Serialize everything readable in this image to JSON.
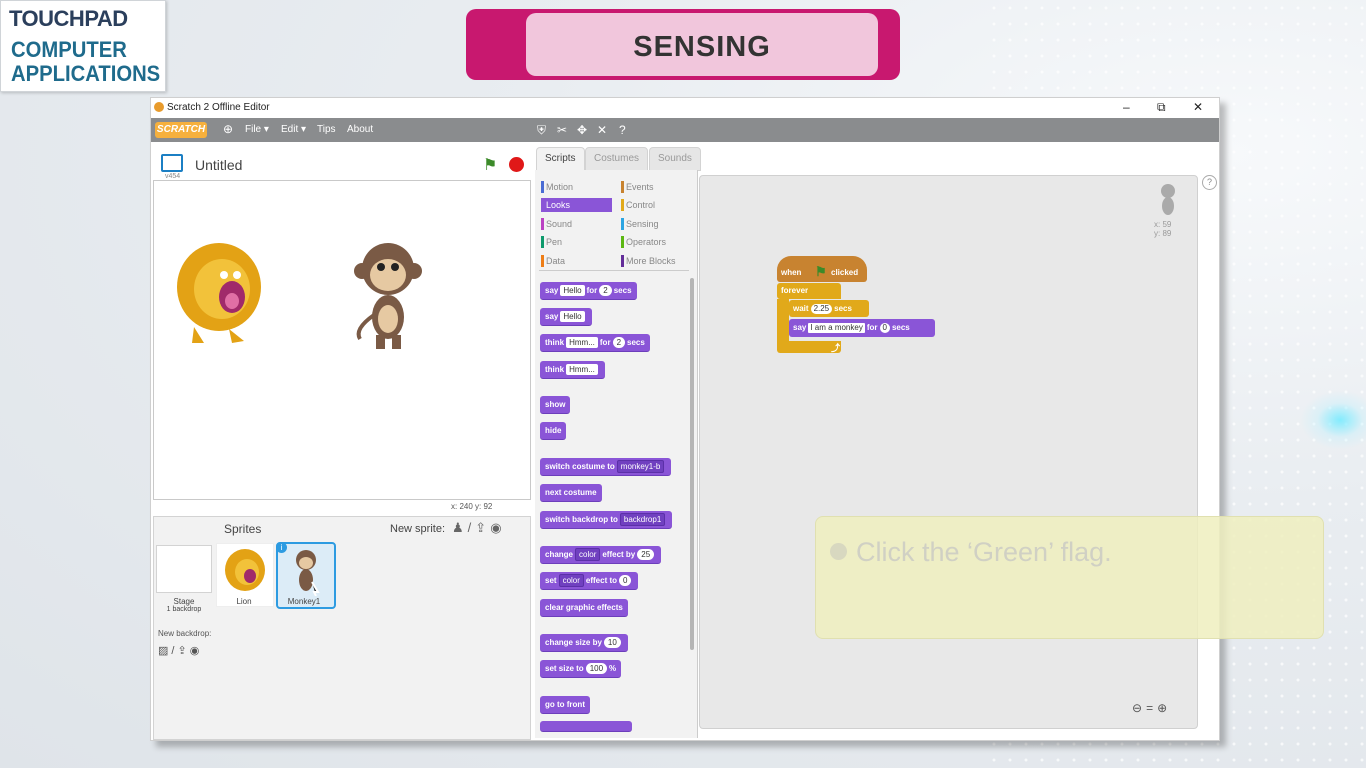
{
  "logo": {
    "brand": "TOUCHPAD",
    "line1": "COMPUTER",
    "line2": "APPLICATIONS"
  },
  "banner": {
    "title": "SENSING"
  },
  "window": {
    "title": "Scratch 2 Offline Editor",
    "controls": {
      "minimize": "–",
      "restore": "⧉",
      "close": "✕"
    }
  },
  "menubar": {
    "logo": "SCRATCH",
    "items": [
      "File ▾",
      "Edit ▾",
      "Tips",
      "About"
    ],
    "tools": [
      "duplicate-icon",
      "delete-icon",
      "grow-icon",
      "shrink-icon",
      "help-icon"
    ]
  },
  "stage": {
    "project_name": "Untitled",
    "version": "v454",
    "coords": "x: 240  y: 92"
  },
  "sprites_panel": {
    "header": "Sprites",
    "new_sprite": "New sprite:",
    "stage_label": "Stage",
    "stage_sub": "1 backdrop",
    "sprites": [
      "Lion",
      "Monkey1"
    ],
    "new_backdrop": "New backdrop:"
  },
  "tabs": [
    "Scripts",
    "Costumes",
    "Sounds"
  ],
  "categories": [
    {
      "label": "Motion",
      "color": "#4a6cd4"
    },
    {
      "label": "Events",
      "color": "#c88330"
    },
    {
      "label": "Looks",
      "color": "#8a55d7"
    },
    {
      "label": "Control",
      "color": "#e1a91a"
    },
    {
      "label": "Sound",
      "color": "#bb42c3"
    },
    {
      "label": "Sensing",
      "color": "#2ca5e2"
    },
    {
      "label": "Pen",
      "color": "#0e9a6c"
    },
    {
      "label": "Operators",
      "color": "#5cb712"
    },
    {
      "label": "Data",
      "color": "#ee7d16"
    },
    {
      "label": "More Blocks",
      "color": "#632d99"
    }
  ],
  "palette_blocks": {
    "say_for": {
      "a": "say",
      "in": "Hello",
      "b": "for",
      "n": "2",
      "c": "secs"
    },
    "say": {
      "a": "say",
      "in": "Hello"
    },
    "think_for": {
      "a": "think",
      "in": "Hmm...",
      "b": "for",
      "n": "2",
      "c": "secs"
    },
    "think": {
      "a": "think",
      "in": "Hmm..."
    },
    "show": "show",
    "hide": "hide",
    "switch_costume": {
      "a": "switch costume to",
      "dd": "monkey1-b"
    },
    "next_costume": "next costume",
    "switch_backdrop": {
      "a": "switch backdrop to",
      "dd": "backdrop1"
    },
    "change_effect": {
      "a": "change",
      "dd": "color",
      "b": "effect by",
      "n": "25"
    },
    "set_effect": {
      "a": "set",
      "dd": "color",
      "b": "effect to",
      "n": "0"
    },
    "clear_effects": "clear graphic effects",
    "change_size": {
      "a": "change size by",
      "n": "10"
    },
    "set_size": {
      "a": "set size to",
      "n": "100",
      "b": "%"
    },
    "go_front": "go to front"
  },
  "script": {
    "when": "when",
    "clicked": "clicked",
    "forever": "forever",
    "wait": {
      "a": "wait",
      "n": "2.25",
      "b": "secs"
    },
    "say": {
      "a": "say",
      "in": "I am a monkey",
      "b": "for",
      "n": "0",
      "c": "secs"
    }
  },
  "sprite_info": {
    "x": "x: 59",
    "y": "y: 89"
  },
  "callout": {
    "text": "Click the ‘Green’ flag."
  },
  "colors": {
    "banner": "#c8186f",
    "banner_inner": "#f1c6dc",
    "looks": "#8a55d7",
    "events": "#c88330",
    "control": "#e1a91a"
  }
}
